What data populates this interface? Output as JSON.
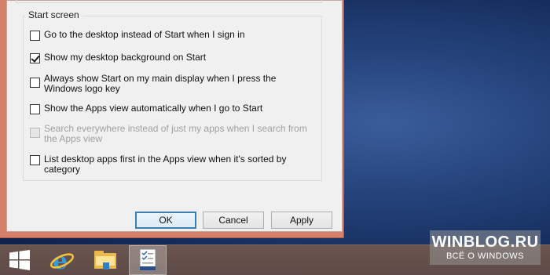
{
  "dialog": {
    "group_title": "Start screen",
    "options": [
      {
        "label": "Go to the desktop instead of Start when I sign in",
        "checked": false,
        "disabled": false
      },
      {
        "label": "Show my desktop background on Start",
        "checked": true,
        "disabled": false
      },
      {
        "label": "Always show Start on my main display when I press the Windows logo key",
        "checked": false,
        "disabled": false
      },
      {
        "label": "Show the Apps view automatically when I go to Start",
        "checked": false,
        "disabled": false
      },
      {
        "label": "Search everywhere instead of just my apps when I search from the Apps view",
        "checked": false,
        "disabled": true
      },
      {
        "label": "List desktop apps first in the Apps view when it's sorted by category",
        "checked": false,
        "disabled": false
      }
    ],
    "buttons": {
      "ok": "OK",
      "cancel": "Cancel",
      "apply": "Apply"
    }
  },
  "taskbar": {
    "items": [
      {
        "name": "start-button",
        "icon": "windows-logo-icon"
      },
      {
        "name": "internet-explorer",
        "icon": "internet-explorer-icon"
      },
      {
        "name": "file-explorer",
        "icon": "folder-icon"
      },
      {
        "name": "taskbar-properties",
        "icon": "taskbar-properties-icon",
        "active": true
      }
    ]
  },
  "watermark": {
    "title": "WINBLOG.RU",
    "subtitle": "ВСЁ О WINDOWS"
  }
}
